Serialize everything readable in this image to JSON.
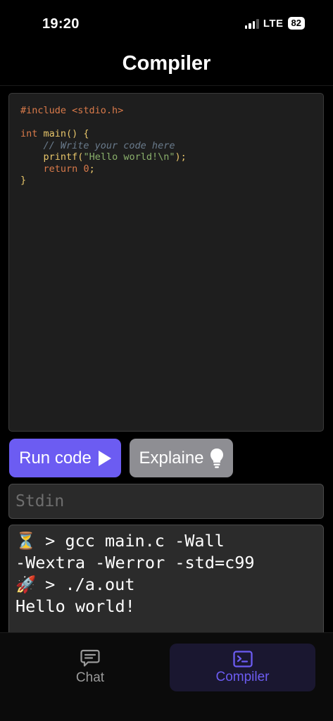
{
  "status_bar": {
    "time": "19:20",
    "network": "LTE",
    "battery": "82"
  },
  "header": {
    "title": "Compiler"
  },
  "editor": {
    "language": "c",
    "code_lines": [
      "#include <stdio.h>",
      "",
      "int main() {",
      "    // Write your code here",
      "    printf(\"Hello world!\\n\");",
      "    return 0;",
      "}"
    ]
  },
  "buttons": {
    "run_label": "Run code",
    "run_icon": "play-icon",
    "explain_label": "Explaine",
    "explain_icon": "lightbulb-icon"
  },
  "stdin": {
    "placeholder": "Stdin",
    "value": ""
  },
  "terminal": {
    "lines": [
      {
        "icon": "hourglass-emoji",
        "glyph": "⏳",
        "text": " > gcc main.c -Wall"
      },
      {
        "icon": "",
        "glyph": "",
        "text": "-Wextra -Werror -std=c99"
      },
      {
        "icon": "rocket-emoji",
        "glyph": "🚀",
        "text": " > ./a.out"
      },
      {
        "icon": "",
        "glyph": "",
        "text": "Hello world!"
      }
    ]
  },
  "tabbar": {
    "tabs": [
      {
        "label": "Chat",
        "icon": "chat-bubble-icon",
        "active": false
      },
      {
        "label": "Compiler",
        "icon": "terminal-icon",
        "active": true
      }
    ]
  },
  "colors": {
    "accent": "#6c5cf2",
    "secondary_button": "#8e8e93",
    "background": "#000000",
    "editor_bg": "#1e1e1e"
  }
}
